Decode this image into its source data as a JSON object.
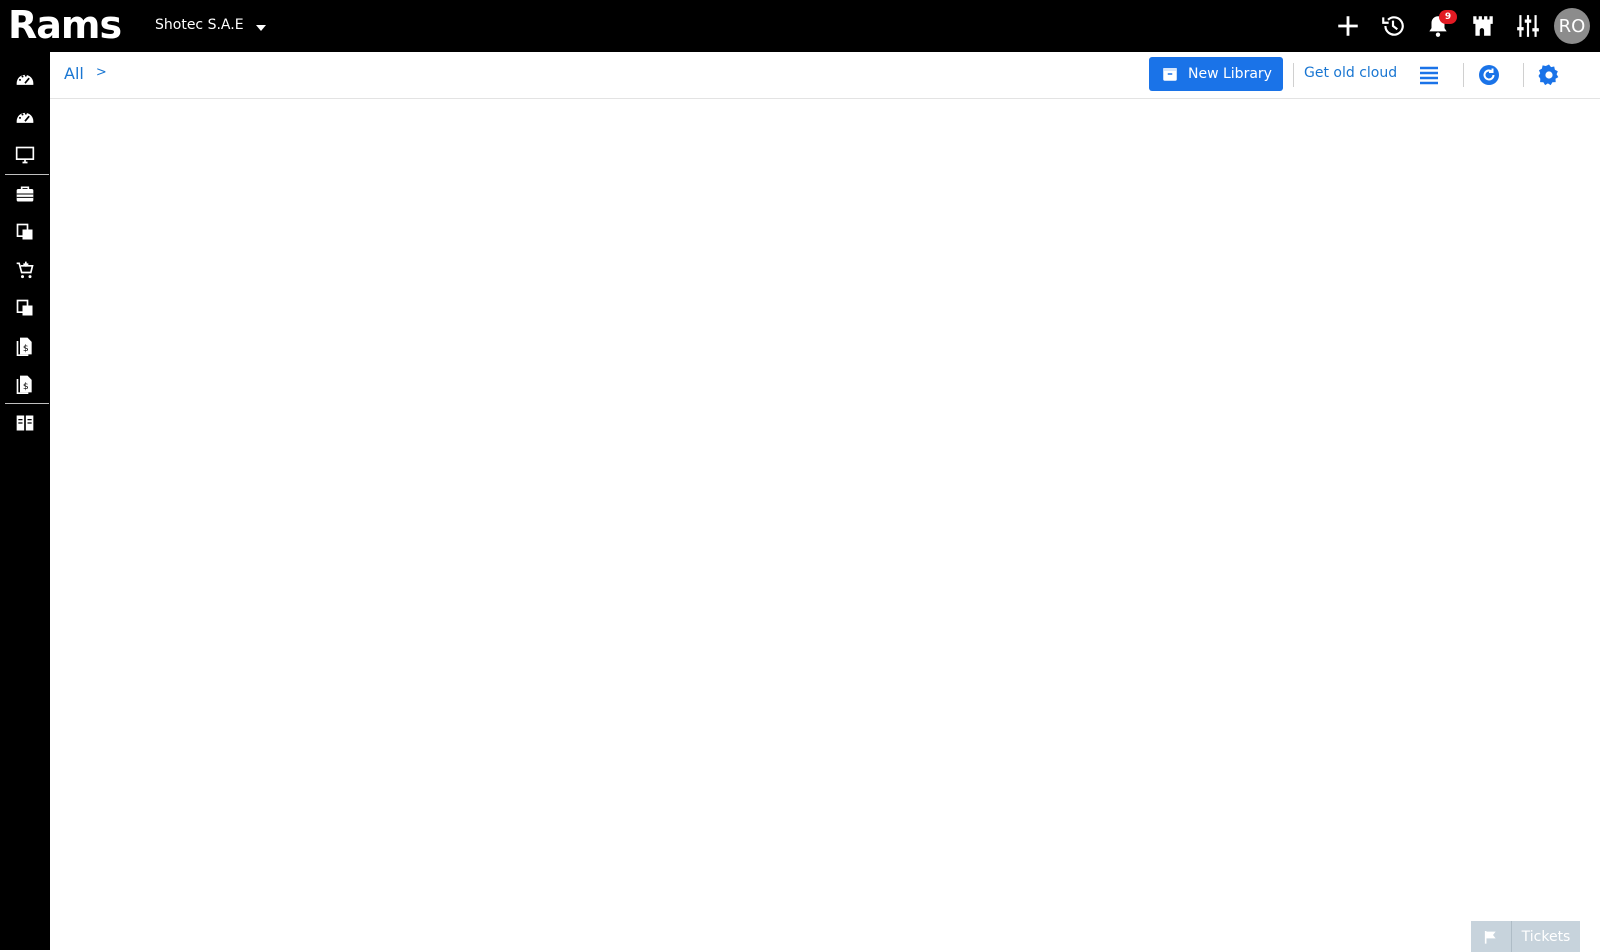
{
  "header": {
    "logo_text": "Rams",
    "company_name": "Shotec S.A.E",
    "notification_count": "9",
    "avatar_initials": "RO",
    "icons": [
      "plus-icon",
      "history-icon",
      "bell-icon",
      "castle-icon",
      "sliders-icon"
    ]
  },
  "sidebar": {
    "items": [
      {
        "icon": "dashboard-icon"
      },
      {
        "icon": "dashboard-alt-icon"
      },
      {
        "icon": "monitor-icon"
      },
      {
        "icon": "briefcase-icon"
      },
      {
        "icon": "documents-icon"
      },
      {
        "icon": "cart-icon"
      },
      {
        "icon": "documents-alt-icon"
      },
      {
        "icon": "invoice-icon"
      },
      {
        "icon": "invoice-alt-icon"
      },
      {
        "icon": "library-icon"
      }
    ]
  },
  "toolbar": {
    "breadcrumb_root": "All",
    "breadcrumb_separator": ">",
    "new_library_label": "New Library",
    "get_old_cloud_label": "Get old cloud",
    "icons": [
      "list-view-icon",
      "refresh-icon",
      "settings-icon"
    ]
  },
  "tickets": {
    "label": "Tickets"
  },
  "colors": {
    "topbar": "#000000",
    "accent": "#1a73e8",
    "link": "#1976d2",
    "badge": "#e21a23",
    "tickets_bg": "#c7d3dc"
  }
}
